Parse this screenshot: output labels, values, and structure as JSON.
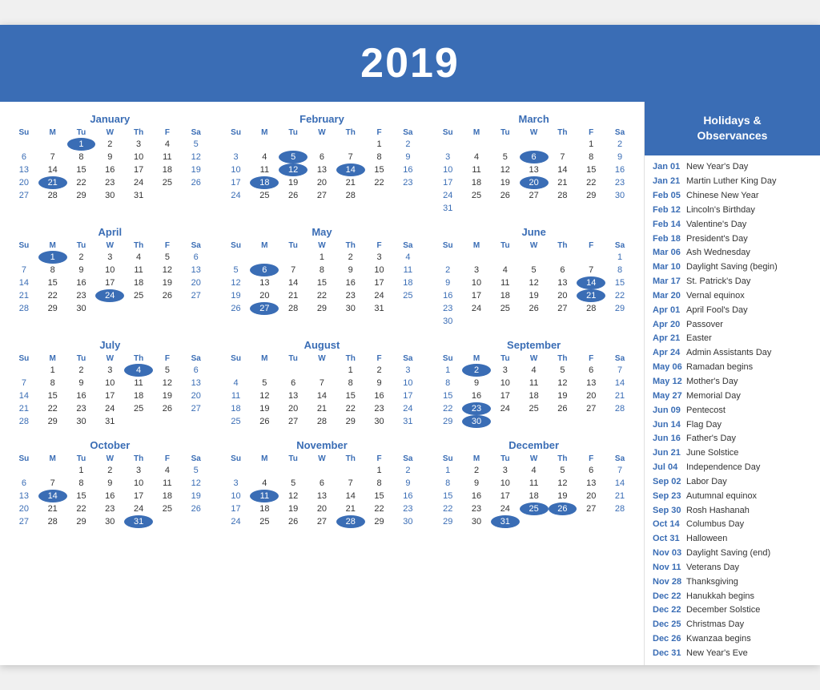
{
  "header": {
    "year": "2019"
  },
  "sidebar": {
    "title": "Holidays &\nObservances",
    "holidays": [
      {
        "date": "Jan 01",
        "name": "New Year's Day"
      },
      {
        "date": "Jan 21",
        "name": "Martin Luther King Day"
      },
      {
        "date": "Feb 05",
        "name": "Chinese New Year"
      },
      {
        "date": "Feb 12",
        "name": "Lincoln's Birthday"
      },
      {
        "date": "Feb 14",
        "name": "Valentine's Day"
      },
      {
        "date": "Feb 18",
        "name": "President's Day"
      },
      {
        "date": "Mar 06",
        "name": "Ash Wednesday"
      },
      {
        "date": "Mar 10",
        "name": "Daylight Saving (begin)"
      },
      {
        "date": "Mar 17",
        "name": "St. Patrick's Day"
      },
      {
        "date": "Mar 20",
        "name": "Vernal equinox"
      },
      {
        "date": "Apr 01",
        "name": "April Fool's Day"
      },
      {
        "date": "Apr 20",
        "name": "Passover"
      },
      {
        "date": "Apr 21",
        "name": "Easter"
      },
      {
        "date": "Apr 24",
        "name": "Admin Assistants Day"
      },
      {
        "date": "May 06",
        "name": "Ramadan begins"
      },
      {
        "date": "May 12",
        "name": "Mother's Day"
      },
      {
        "date": "May 27",
        "name": "Memorial Day"
      },
      {
        "date": "Jun 09",
        "name": "Pentecost"
      },
      {
        "date": "Jun 14",
        "name": "Flag Day"
      },
      {
        "date": "Jun 16",
        "name": "Father's Day"
      },
      {
        "date": "Jun 21",
        "name": "June Solstice"
      },
      {
        "date": "Jul 04",
        "name": "Independence Day"
      },
      {
        "date": "Sep 02",
        "name": "Labor Day"
      },
      {
        "date": "Sep 23",
        "name": "Autumnal equinox"
      },
      {
        "date": "Sep 30",
        "name": "Rosh Hashanah"
      },
      {
        "date": "Oct 14",
        "name": "Columbus Day"
      },
      {
        "date": "Oct 31",
        "name": "Halloween"
      },
      {
        "date": "Nov 03",
        "name": "Daylight Saving (end)"
      },
      {
        "date": "Nov 11",
        "name": "Veterans Day"
      },
      {
        "date": "Nov 28",
        "name": "Thanksgiving"
      },
      {
        "date": "Dec 22",
        "name": "Hanukkah begins"
      },
      {
        "date": "Dec 22",
        "name": "December Solstice"
      },
      {
        "date": "Dec 25",
        "name": "Christmas Day"
      },
      {
        "date": "Dec 26",
        "name": "Kwanzaa begins"
      },
      {
        "date": "Dec 31",
        "name": "New Year's Eve"
      }
    ]
  },
  "months": [
    {
      "name": "January",
      "weeks": [
        [
          null,
          null,
          "1h",
          "2",
          "3",
          "4",
          "5s"
        ],
        [
          "6su",
          "7",
          "8",
          "9",
          "10",
          "11",
          "12s"
        ],
        [
          "13su",
          "14",
          "15",
          "16",
          "17",
          "18",
          "19s"
        ],
        [
          "20su",
          "21h",
          "22",
          "23",
          "24",
          "25",
          "26s"
        ],
        [
          "27su",
          "28",
          "29",
          "30",
          "31",
          null,
          null
        ]
      ]
    },
    {
      "name": "February",
      "weeks": [
        [
          null,
          null,
          null,
          null,
          null,
          "1",
          "2s"
        ],
        [
          "3su",
          "4",
          "5h",
          "6",
          "7",
          "8",
          "9s"
        ],
        [
          "10su",
          "11",
          "12h",
          "13",
          "14h",
          "15",
          "16s"
        ],
        [
          "17su",
          "18h",
          "19",
          "20",
          "21",
          "22",
          "23s"
        ],
        [
          "24su",
          "25",
          "26",
          "27",
          "28",
          null,
          null
        ]
      ]
    },
    {
      "name": "March",
      "weeks": [
        [
          null,
          null,
          null,
          null,
          null,
          "1",
          "2s"
        ],
        [
          "3su",
          "4",
          "5",
          "6h",
          "7",
          "8",
          "9s"
        ],
        [
          "10su",
          "11",
          "12",
          "13",
          "14",
          "15",
          "16s"
        ],
        [
          "17su",
          "18",
          "19",
          "20h",
          "21",
          "22",
          "23s"
        ],
        [
          "24su",
          "25",
          "26",
          "27",
          "28",
          "29",
          "30s"
        ],
        [
          "31su",
          null,
          null,
          null,
          null,
          null,
          null
        ]
      ]
    },
    {
      "name": "April",
      "weeks": [
        [
          null,
          "1h",
          "2",
          "3",
          "4",
          "5",
          "6s"
        ],
        [
          "7su",
          "8",
          "9",
          "10",
          "11",
          "12",
          "13s"
        ],
        [
          "14su",
          "15",
          "16",
          "17",
          "18",
          "19",
          "20s"
        ],
        [
          "21su",
          "22",
          "23",
          "24h",
          "25",
          "26",
          "27s"
        ],
        [
          "28su",
          "29",
          "30",
          null,
          null,
          null,
          null
        ]
      ]
    },
    {
      "name": "May",
      "weeks": [
        [
          null,
          null,
          null,
          "1",
          "2",
          "3",
          "4s"
        ],
        [
          "5su",
          "6h",
          "7",
          "8",
          "9",
          "10",
          "11s"
        ],
        [
          "12su",
          "13",
          "14",
          "15",
          "16",
          "17",
          "18s"
        ],
        [
          "19su",
          "20",
          "21",
          "22",
          "23",
          "24",
          "25s"
        ],
        [
          "26su",
          "27h",
          "28",
          "29",
          "30",
          "31",
          null
        ]
      ]
    },
    {
      "name": "June",
      "weeks": [
        [
          null,
          null,
          null,
          null,
          null,
          null,
          "1s"
        ],
        [
          "2su",
          "3",
          "4",
          "5",
          "6",
          "7",
          "8s"
        ],
        [
          "9su",
          "10",
          "11",
          "12",
          "13",
          "14h",
          "15s"
        ],
        [
          "16su",
          "17",
          "18",
          "19",
          "20",
          "21h",
          "22s"
        ],
        [
          "23su",
          "24",
          "25",
          "26",
          "27",
          "28",
          "29s"
        ],
        [
          "30su",
          null,
          null,
          null,
          null,
          null,
          null
        ]
      ]
    },
    {
      "name": "July",
      "weeks": [
        [
          null,
          "1",
          "2",
          "3",
          "4h",
          "5",
          "6s"
        ],
        [
          "7su",
          "8",
          "9",
          "10",
          "11",
          "12",
          "13s"
        ],
        [
          "14su",
          "15",
          "16",
          "17",
          "18",
          "19",
          "20s"
        ],
        [
          "21su",
          "22",
          "23",
          "24",
          "25",
          "26",
          "27s"
        ],
        [
          "28su",
          "29",
          "30",
          "31",
          null,
          null,
          null
        ]
      ]
    },
    {
      "name": "August",
      "weeks": [
        [
          null,
          null,
          null,
          null,
          "1",
          "2",
          "3s"
        ],
        [
          "4su",
          "5",
          "6",
          "7",
          "8",
          "9",
          "10s"
        ],
        [
          "11su",
          "12",
          "13",
          "14",
          "15",
          "16",
          "17s"
        ],
        [
          "18su",
          "19",
          "20",
          "21",
          "22",
          "23",
          "24s"
        ],
        [
          "25su",
          "26",
          "27",
          "28",
          "29",
          "30",
          "31s"
        ]
      ]
    },
    {
      "name": "September",
      "weeks": [
        [
          "1su",
          "2h",
          "3",
          "4",
          "5",
          "6",
          "7s"
        ],
        [
          "8su",
          "9",
          "10",
          "11",
          "12",
          "13",
          "14s"
        ],
        [
          "15su",
          "16",
          "17",
          "18",
          "19",
          "20",
          "21s"
        ],
        [
          "22su",
          "23h",
          "24",
          "25",
          "26",
          "27",
          "28s"
        ],
        [
          "29su",
          "30h",
          null,
          null,
          null,
          null,
          null
        ]
      ]
    },
    {
      "name": "October",
      "weeks": [
        [
          null,
          null,
          "1",
          "2",
          "3",
          "4",
          "5s"
        ],
        [
          "6su",
          "7",
          "8",
          "9",
          "10",
          "11",
          "12s"
        ],
        [
          "13su",
          "14h",
          "15",
          "16",
          "17",
          "18",
          "19s"
        ],
        [
          "20su",
          "21",
          "22",
          "23",
          "24",
          "25",
          "26s"
        ],
        [
          "27su",
          "28",
          "29",
          "30",
          "31h",
          null,
          null
        ]
      ]
    },
    {
      "name": "November",
      "weeks": [
        [
          null,
          null,
          null,
          null,
          null,
          "1",
          "2s"
        ],
        [
          "3su",
          "4",
          "5",
          "6",
          "7",
          "8",
          "9s"
        ],
        [
          "10su",
          "11h",
          "12",
          "13",
          "14",
          "15",
          "16s"
        ],
        [
          "17su",
          "18",
          "19",
          "20",
          "21",
          "22",
          "23s"
        ],
        [
          "24su",
          "25",
          "26",
          "27",
          "28h",
          "29",
          "30s"
        ]
      ]
    },
    {
      "name": "December",
      "weeks": [
        [
          "1su",
          "2",
          "3",
          "4",
          "5",
          "6",
          "7s"
        ],
        [
          "8su",
          "9",
          "10",
          "11",
          "12",
          "13",
          "14s"
        ],
        [
          "15su",
          "16",
          "17",
          "18",
          "19",
          "20",
          "21s"
        ],
        [
          "22su",
          "23",
          "24",
          "25h",
          "26h",
          "27",
          "28s"
        ],
        [
          "29su",
          "30",
          "31h",
          null,
          null,
          null,
          null
        ]
      ]
    }
  ]
}
